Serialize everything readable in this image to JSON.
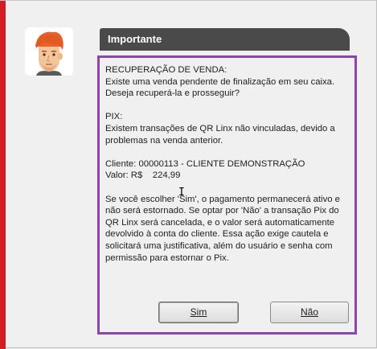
{
  "dialog": {
    "title": "Importante",
    "recovery_heading": "RECUPERAÇÃO DE VENDA:",
    "recovery_line1": "Existe uma venda pendente de finalização em seu caixa.",
    "recovery_line2": "Deseja recuperá-la e prosseguir?",
    "pix_heading": "PIX:",
    "pix_line1": "Existem transações de QR Linx não vinculadas, devido a",
    "pix_line2": "problemas na venda anterior.",
    "client_line": "Cliente: 00000113 - CLIENTE DEMONSTRAÇÃO",
    "value_line": "Valor: R$    224,99",
    "explanation": [
      "Se você escolher 'Sim', o pagamento permanecerá ativo e",
      "não será estornado. Se optar por 'Não' a transação Pix do",
      "QR Linx será cancelada, e o valor será automaticamente",
      "devolvido à conta do cliente. Essa ação exige cautela e",
      "solicitará uma justificativa, além do usuário e senha com",
      "permissão para estornar o Pix."
    ]
  },
  "buttons": {
    "yes_label": "Sim",
    "no_label": "Não"
  },
  "icons": {
    "avatar": "cartoon-person-avatar-icon",
    "text_cursor": "text-cursor-icon"
  },
  "colors": {
    "accent_bar": "#d21f26",
    "title_bar": "#4a4a4a",
    "content_border": "#8e44ad"
  }
}
